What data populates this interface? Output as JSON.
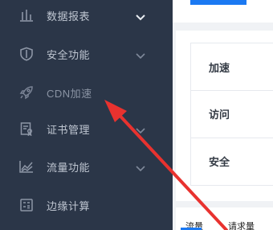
{
  "sidebar": {
    "items": [
      {
        "label": "数据报表",
        "icon": "bar-chart-icon",
        "has_chevron": true
      },
      {
        "label": "安全功能",
        "icon": "shield-icon",
        "has_chevron": true
      },
      {
        "label": "CDN加速",
        "icon": "rocket-icon",
        "has_chevron": false
      },
      {
        "label": "证书管理",
        "icon": "certificate-icon",
        "has_chevron": true
      },
      {
        "label": "流量功能",
        "icon": "traffic-chart-icon",
        "has_chevron": true
      },
      {
        "label": "边缘计算",
        "icon": "calculator-icon",
        "has_chevron": false
      }
    ]
  },
  "main": {
    "metrics": [
      {
        "label": "加速"
      },
      {
        "label": "访问"
      },
      {
        "label": "安全"
      }
    ],
    "bottom_tabs": [
      {
        "label": "流量"
      },
      {
        "label": "请求量"
      }
    ]
  },
  "colors": {
    "sidebar_bg": "#2b3648",
    "accent": "#1b79f2",
    "arrow": "#e8322f"
  }
}
